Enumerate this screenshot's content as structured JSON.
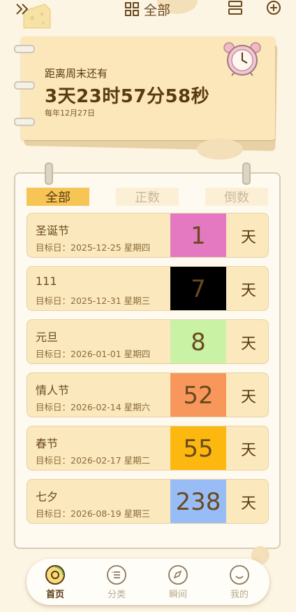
{
  "header": {
    "title": "全部"
  },
  "countdown": {
    "label": "距离周末还有",
    "value": "3天23时57分58秒",
    "subtitle": "每年12月27日"
  },
  "tabs": [
    {
      "label": "全部",
      "active": true
    },
    {
      "label": "正数",
      "active": false
    },
    {
      "label": "倒数",
      "active": false
    }
  ],
  "events": [
    {
      "name": "圣诞节",
      "date": "目标日：2025-12-25 星期四",
      "days": "1",
      "unit": "天",
      "color": "#e479c2"
    },
    {
      "name": "111",
      "date": "目标日：2025-12-31 星期三",
      "days": "7",
      "unit": "天",
      "color": "#000000"
    },
    {
      "name": "元旦",
      "date": "目标日：2026-01-01 星期四",
      "days": "8",
      "unit": "天",
      "color": "#c9f2a5"
    },
    {
      "name": "情人节",
      "date": "目标日：2026-02-14 星期六",
      "days": "52",
      "unit": "天",
      "color": "#f7975c"
    },
    {
      "name": "春节",
      "date": "目标日：2026-02-17 星期二",
      "days": "55",
      "unit": "天",
      "color": "#fcb80f"
    },
    {
      "name": "七夕",
      "date": "目标日：2026-08-19 星期三",
      "days": "238",
      "unit": "天",
      "color": "#98bdf6"
    }
  ],
  "nav": [
    {
      "label": "首页",
      "icon": "home-disc-icon",
      "active": true
    },
    {
      "label": "分类",
      "icon": "list-icon",
      "active": false
    },
    {
      "label": "瞬间",
      "icon": "compass-icon",
      "active": false
    },
    {
      "label": "我的",
      "icon": "smiley-icon",
      "active": false
    }
  ]
}
